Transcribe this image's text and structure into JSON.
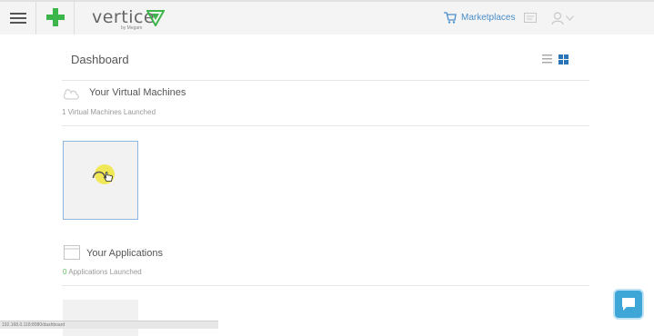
{
  "app": {
    "brand": "vertice",
    "brand_sub": "by Megam"
  },
  "header": {
    "menu_icon": "hamburger-icon",
    "add_icon": "plus-icon",
    "marketplaces_label": "Marketplaces",
    "cart_icon": "cart-icon",
    "messages_icon": "message-icon",
    "user_icon": "user-icon",
    "accent": "#4a8ecb",
    "add_color": "#3cb54a"
  },
  "dashboard": {
    "title": "Dashboard",
    "view_toggle": {
      "list_icon": "list-view-icon",
      "grid_icon": "grid-view-icon"
    }
  },
  "sections": {
    "vms": {
      "title": "Your Virtual Machines",
      "count_text": "1 Virtual Machines Launched",
      "icon": "cloud-icon"
    },
    "apps": {
      "title": "Your Applications",
      "count_num": "0",
      "count_rest": " Applications Launched",
      "icon": "window-icon"
    }
  },
  "statusbar": {
    "url": "192.168.0.118:8080/dashboard"
  },
  "chat": {
    "icon": "chat-icon",
    "color": "#3fa6d8"
  }
}
